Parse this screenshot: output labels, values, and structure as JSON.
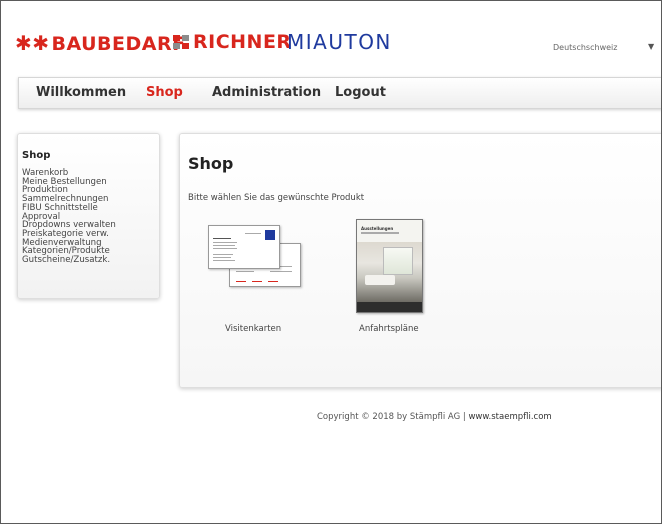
{
  "brand": {
    "logos": [
      "BAUBEDARF",
      "RICHNER",
      "MIAUTON"
    ],
    "brand_red": "#d8261d",
    "brand_blue": "#1f3a9e"
  },
  "language": {
    "selected": "Deutschschweiz",
    "arrow": "▼"
  },
  "nav": {
    "items": [
      {
        "label": "Willkommen"
      },
      {
        "label": "Shop",
        "active": true
      },
      {
        "label": "Administration"
      },
      {
        "label": "Logout"
      }
    ]
  },
  "sidebar": {
    "title": "Shop",
    "items": [
      "Warenkorb",
      "Meine Bestellungen",
      "Produktion",
      "Sammelrechnungen",
      "FIBU Schnittstelle",
      "Approval",
      "Dropdowns verwalten",
      "Preiskategorie verw.",
      "Medienverwaltung",
      "Kategorien/Produkte",
      "Gutscheine/Zusatzk."
    ]
  },
  "main": {
    "title": "Shop",
    "subtitle": "Bitte wählen Sie das gewünschte Produkt",
    "products": [
      {
        "label": "Visitenkarten",
        "icon": "business-card-icon"
      },
      {
        "label": "Anfahrtspläne",
        "icon": "brochure-icon",
        "thumb_title": "Ausstellungen"
      }
    ]
  },
  "footer": {
    "copyright": "Copyright © 2018 by Stämpfli AG",
    "separator": "|",
    "website": "www.staempfli.com"
  }
}
